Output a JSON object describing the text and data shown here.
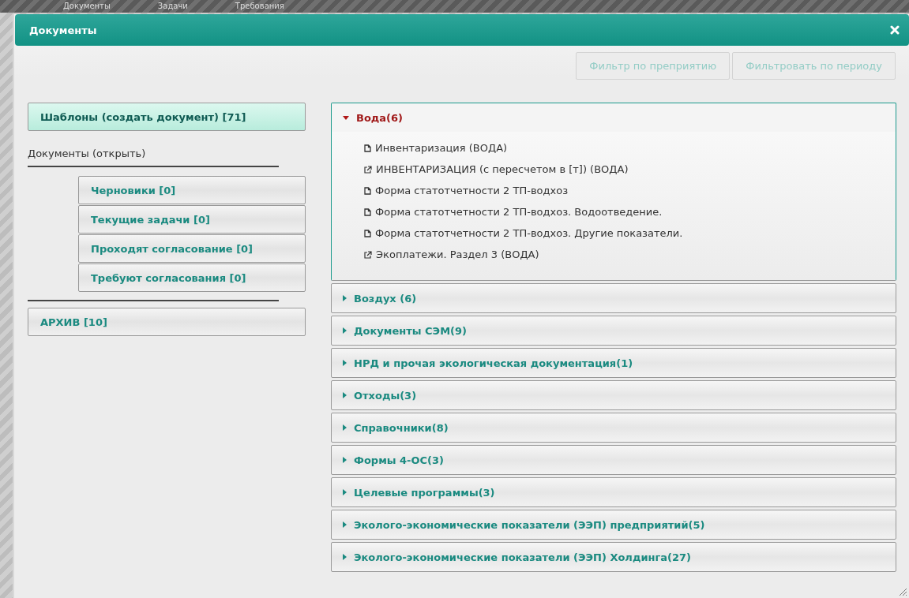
{
  "background_tabs": [
    {
      "label": "Документы"
    },
    {
      "label": "Задачи"
    },
    {
      "label": "Требования"
    }
  ],
  "window": {
    "title": "Документы"
  },
  "toolbar": {
    "buttons": [
      {
        "label": "Фильтр по преприятию",
        "disabled": true
      },
      {
        "label": "Фильтровать по периоду",
        "disabled": true
      }
    ]
  },
  "sidebar": {
    "templates_button": {
      "label": "Шаблоны (создать документ) [71]",
      "selected": true
    },
    "documents_heading": "Документы (открыть)",
    "document_items": [
      {
        "label": "Черновики [0]",
        "selected": false
      },
      {
        "label": "Текущие задачи [0]",
        "selected": false
      },
      {
        "label": "Проходят согласование [0]",
        "selected": false
      },
      {
        "label": "Требуют согласования [0]",
        "selected": false
      }
    ],
    "archive_button": {
      "label": "АРХИВ [10]",
      "selected": false
    }
  },
  "accordion": [
    {
      "title": "Вода(6)",
      "expanded": true,
      "items": [
        {
          "kind": "document",
          "label": "Инвентаризация (ВОДА)"
        },
        {
          "kind": "link",
          "label": "ИНВЕНТАРИЗАЦИЯ (с пересчетом в [т]) (ВОДА)"
        },
        {
          "kind": "document",
          "label": "Форма статотчетности 2 ТП-водхоз"
        },
        {
          "kind": "document",
          "label": "Форма статотчетности 2 ТП-водхоз. Водоотведение."
        },
        {
          "kind": "document",
          "label": "Форма статотчетности 2 ТП-водхоз. Другие показатели."
        },
        {
          "kind": "link",
          "label": "Экоплатежи. Раздел 3 (ВОДА)"
        }
      ]
    },
    {
      "title": "Воздух (6)",
      "expanded": false
    },
    {
      "title": "Документы СЭМ(9)",
      "expanded": false
    },
    {
      "title": "НРД и прочая экологическая документация(1)",
      "expanded": false
    },
    {
      "title": "Отходы(3)",
      "expanded": false
    },
    {
      "title": "Справочники(8)",
      "expanded": false
    },
    {
      "title": "Формы 4-ОС(3)",
      "expanded": false
    },
    {
      "title": "Целевые программы(3)",
      "expanded": false
    },
    {
      "title": "Эколого-экономические показатели (ЭЭП) предприятий(5)",
      "expanded": false
    },
    {
      "title": "Эколого-экономические показатели (ЭЭП) Холдинга(27)",
      "expanded": false
    }
  ]
}
